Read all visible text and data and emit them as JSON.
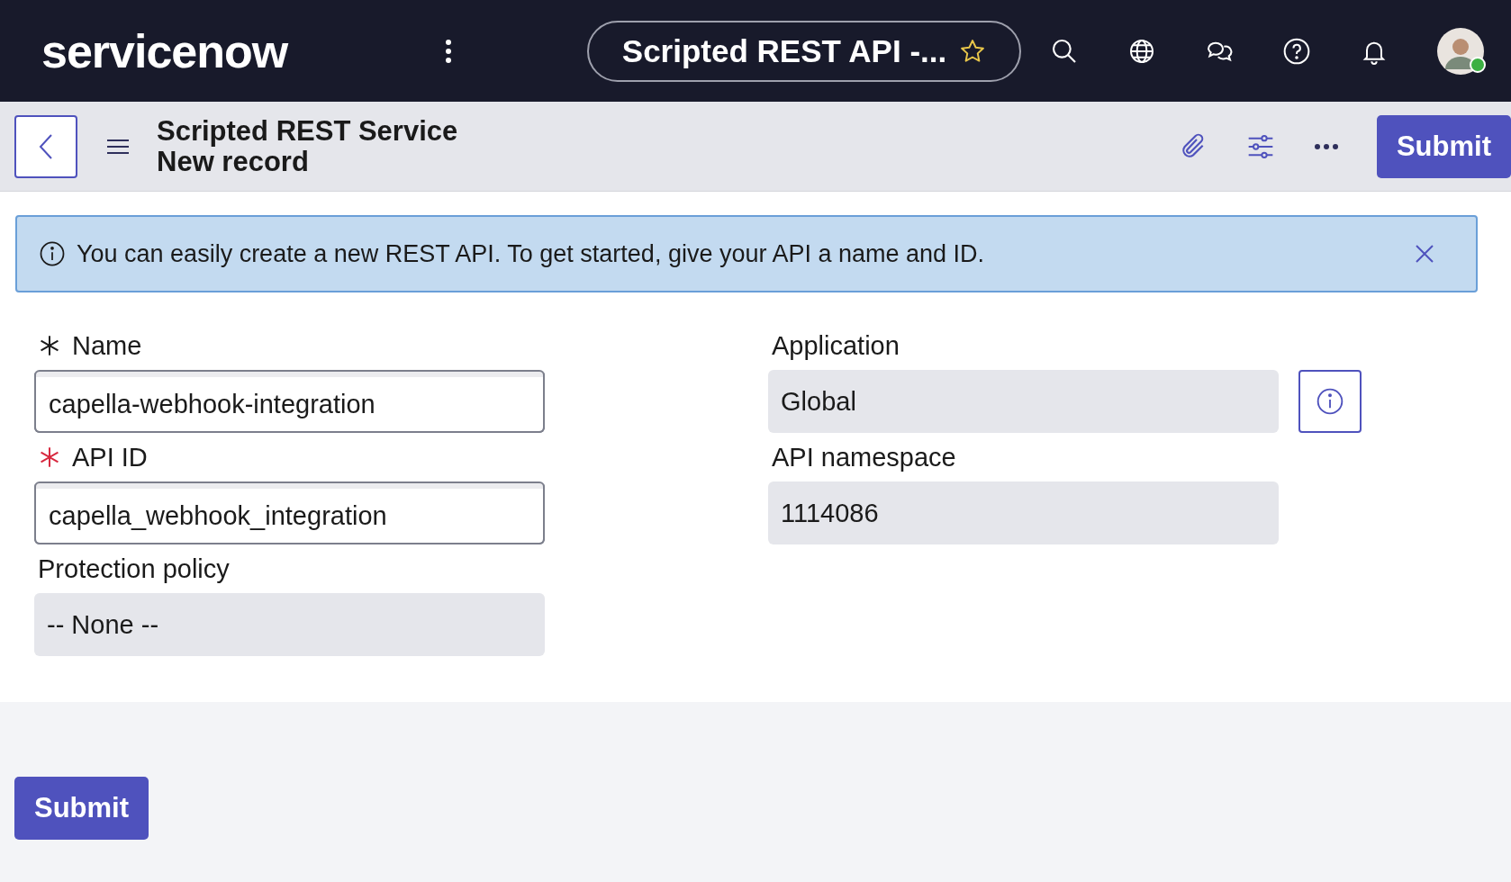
{
  "top_bar": {
    "logo": "servicenow",
    "tab_title": "Scripted REST API -...",
    "favorite": false
  },
  "header": {
    "title": "Scripted REST Service",
    "subtitle": "New record",
    "submit": "Submit"
  },
  "banner": {
    "message": "You can easily create a new REST API. To get started, give your API a name and ID."
  },
  "left_fields": [
    {
      "label": "Name",
      "value": "capella-webhook-integration",
      "required": true,
      "color": "#1a1a1a",
      "readonly": false
    },
    {
      "label": "API ID",
      "value": "capella_webhook_integration",
      "required": true,
      "color": "#d7263d",
      "readonly": false
    },
    {
      "label": "Protection policy",
      "value": "-- None --",
      "required": false,
      "readonly": true
    }
  ],
  "right_fields": [
    {
      "label": "Application",
      "value": "Global",
      "readonly": true,
      "info_button": true
    },
    {
      "label": "API namespace",
      "value": "1114086",
      "readonly": true,
      "info_button": false
    }
  ],
  "footer": {
    "submit": "Submit"
  }
}
